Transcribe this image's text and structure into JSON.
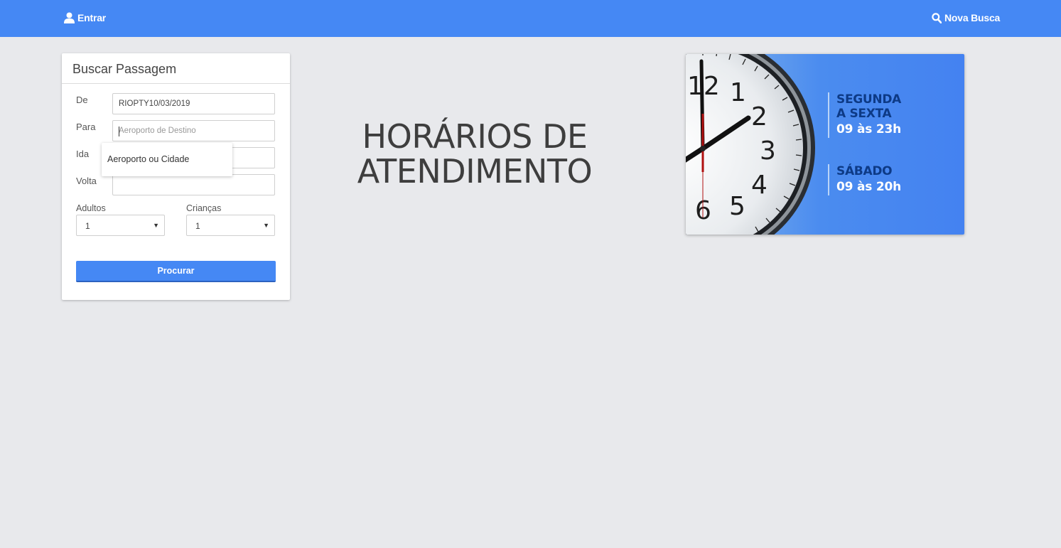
{
  "header": {
    "login_label": "Entrar",
    "search_label": "Nova Busca",
    "icons": {
      "login": "user-icon",
      "search": "search-icon"
    },
    "background_color": "#4588f4"
  },
  "search_form": {
    "title": "Buscar Passagem",
    "from": {
      "label": "De",
      "value": "RIOPTY10/03/2019"
    },
    "to": {
      "label": "Para",
      "placeholder": "Aeroporto de Destino"
    },
    "departure": {
      "label": "Ida",
      "value": ""
    },
    "return": {
      "label": "Volta",
      "value": ""
    },
    "autocomplete_option": "Aeroporto ou Cidade",
    "adults": {
      "label": "Adultos",
      "selected": "1"
    },
    "children": {
      "label": "Crianças",
      "selected": "1"
    },
    "submit_label": "Procurar",
    "accent_color": "#4588f4"
  },
  "main": {
    "heading_line1": "HORÁRIOS DE",
    "heading_line2": "ATENDIMENTO"
  },
  "banner": {
    "weekday_title_line1": "SEGUNDA",
    "weekday_title_line2": "A SEXTA",
    "weekday_hours": "09 às 23h",
    "saturday_title": "SÁBADO",
    "saturday_hours": "09 às 20h",
    "clock_numbers": [
      "12",
      "1",
      "2",
      "3",
      "4",
      "5",
      "6"
    ],
    "title_color": "#0d3a86"
  }
}
